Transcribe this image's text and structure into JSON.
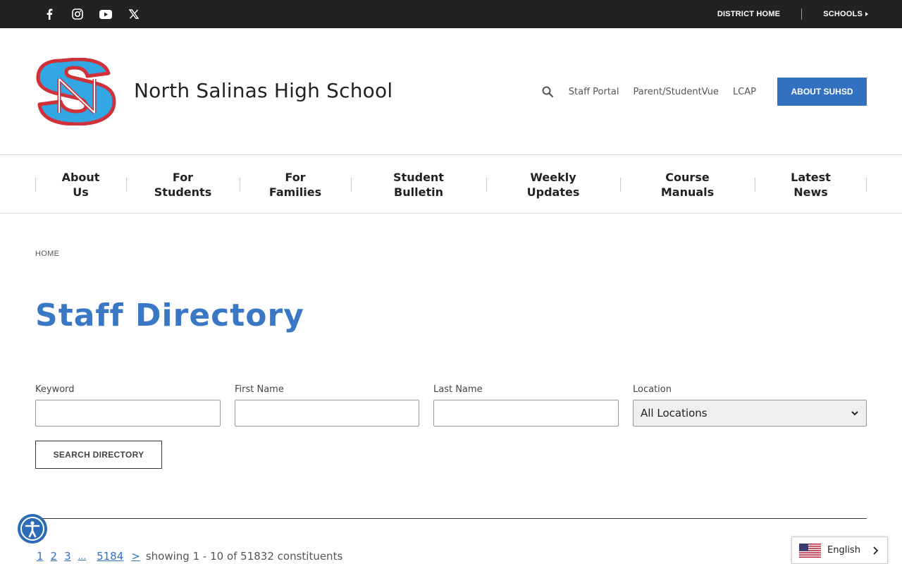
{
  "topbar": {
    "social": [
      {
        "icon": "facebook-icon"
      },
      {
        "icon": "instagram-icon"
      },
      {
        "icon": "youtube-icon"
      },
      {
        "icon": "x-twitter-icon"
      }
    ],
    "district_home": "DISTRICT HOME",
    "schools": "SCHOOLS"
  },
  "header": {
    "school_name": "North Salinas High School",
    "links": [
      "Staff Portal",
      "Parent/StudentVue",
      "LCAP"
    ],
    "about_button": "ABOUT SUHSD"
  },
  "nav": {
    "items": [
      {
        "line1": "About",
        "line2": "Us"
      },
      {
        "line1": "For",
        "line2": "Students"
      },
      {
        "line1": "For",
        "line2": "Families"
      },
      {
        "line1": "Student",
        "line2": "Bulletin"
      },
      {
        "line1": "Weekly",
        "line2": "Updates"
      },
      {
        "line1": "Course",
        "line2": "Manuals"
      },
      {
        "line1": "Latest",
        "line2": "News"
      }
    ]
  },
  "breadcrumb": "HOME",
  "page_title": "Staff Directory",
  "form": {
    "keyword_label": "Keyword",
    "first_name_label": "First Name",
    "last_name_label": "Last Name",
    "location_label": "Location",
    "location_value": "All Locations",
    "search_button": "SEARCH DIRECTORY"
  },
  "pagination": {
    "pages": [
      "1",
      "2",
      "3",
      "...",
      "5184",
      ">"
    ],
    "info": "showing 1 - 10 of 51832 constituents"
  },
  "language": {
    "label": "English"
  },
  "colors": {
    "accent": "#3270c0",
    "title": "#3a78c6",
    "topbar": "#222222"
  }
}
